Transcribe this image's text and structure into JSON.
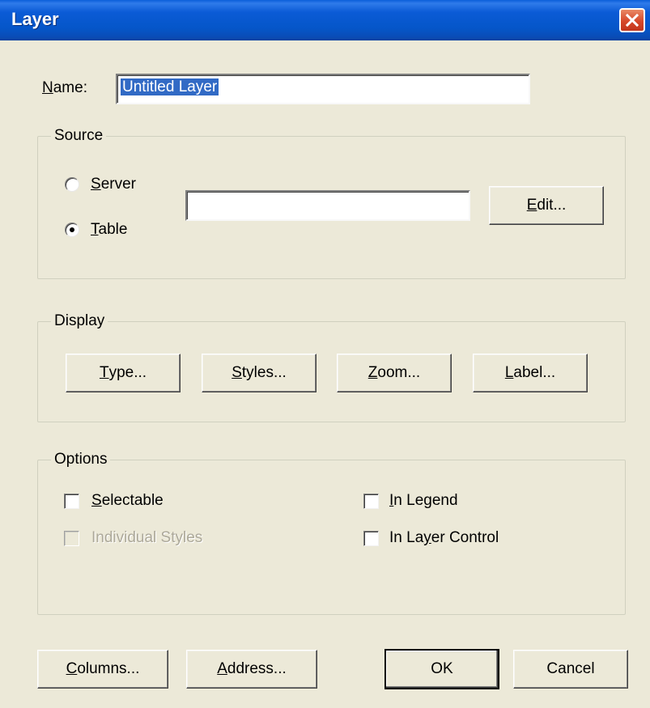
{
  "window": {
    "title": "Layer",
    "close_icon": "close-icon"
  },
  "name_field": {
    "label_accel": "N",
    "label_rest": "ame:",
    "value": "Untitled Layer"
  },
  "source": {
    "title": "Source",
    "server_radio": {
      "accel": "S",
      "rest": "erver",
      "checked": false
    },
    "table_radio": {
      "accel": "T",
      "rest": "able",
      "checked": true
    },
    "source_value": "",
    "edit_button": {
      "accel": "E",
      "rest": "dit..."
    }
  },
  "display": {
    "title": "Display",
    "type_button": {
      "accel": "T",
      "rest": "ype..."
    },
    "styles_button": {
      "accel": "S",
      "rest": "tyles..."
    },
    "zoom_button": {
      "accel": "Z",
      "rest": "oom..."
    },
    "label_button": {
      "accel": "L",
      "rest": "abel..."
    }
  },
  "options": {
    "title": "Options",
    "selectable": {
      "accel": "S",
      "rest": "electable",
      "checked": false,
      "enabled": true
    },
    "individual_styles": {
      "label": "Individual Styles",
      "checked": false,
      "enabled": false
    },
    "in_legend": {
      "accel": "I",
      "rest": "n Legend",
      "checked": false,
      "enabled": true
    },
    "in_layer_control": {
      "pre": "In La",
      "accel": "y",
      "rest": "er Control",
      "checked": false,
      "enabled": true
    }
  },
  "footer": {
    "columns_button": {
      "accel": "C",
      "rest": "olumns..."
    },
    "address_button": {
      "accel": "A",
      "rest": "ddress..."
    },
    "ok_button": {
      "label": "OK"
    },
    "cancel_button": {
      "label": "Cancel"
    }
  },
  "colors": {
    "dialog_bg": "#ECE9D8",
    "titlebar_blue": "#0556C9",
    "close_red": "#D6482A",
    "selection": "#316AC5",
    "disabled_text": "#ACA899"
  }
}
